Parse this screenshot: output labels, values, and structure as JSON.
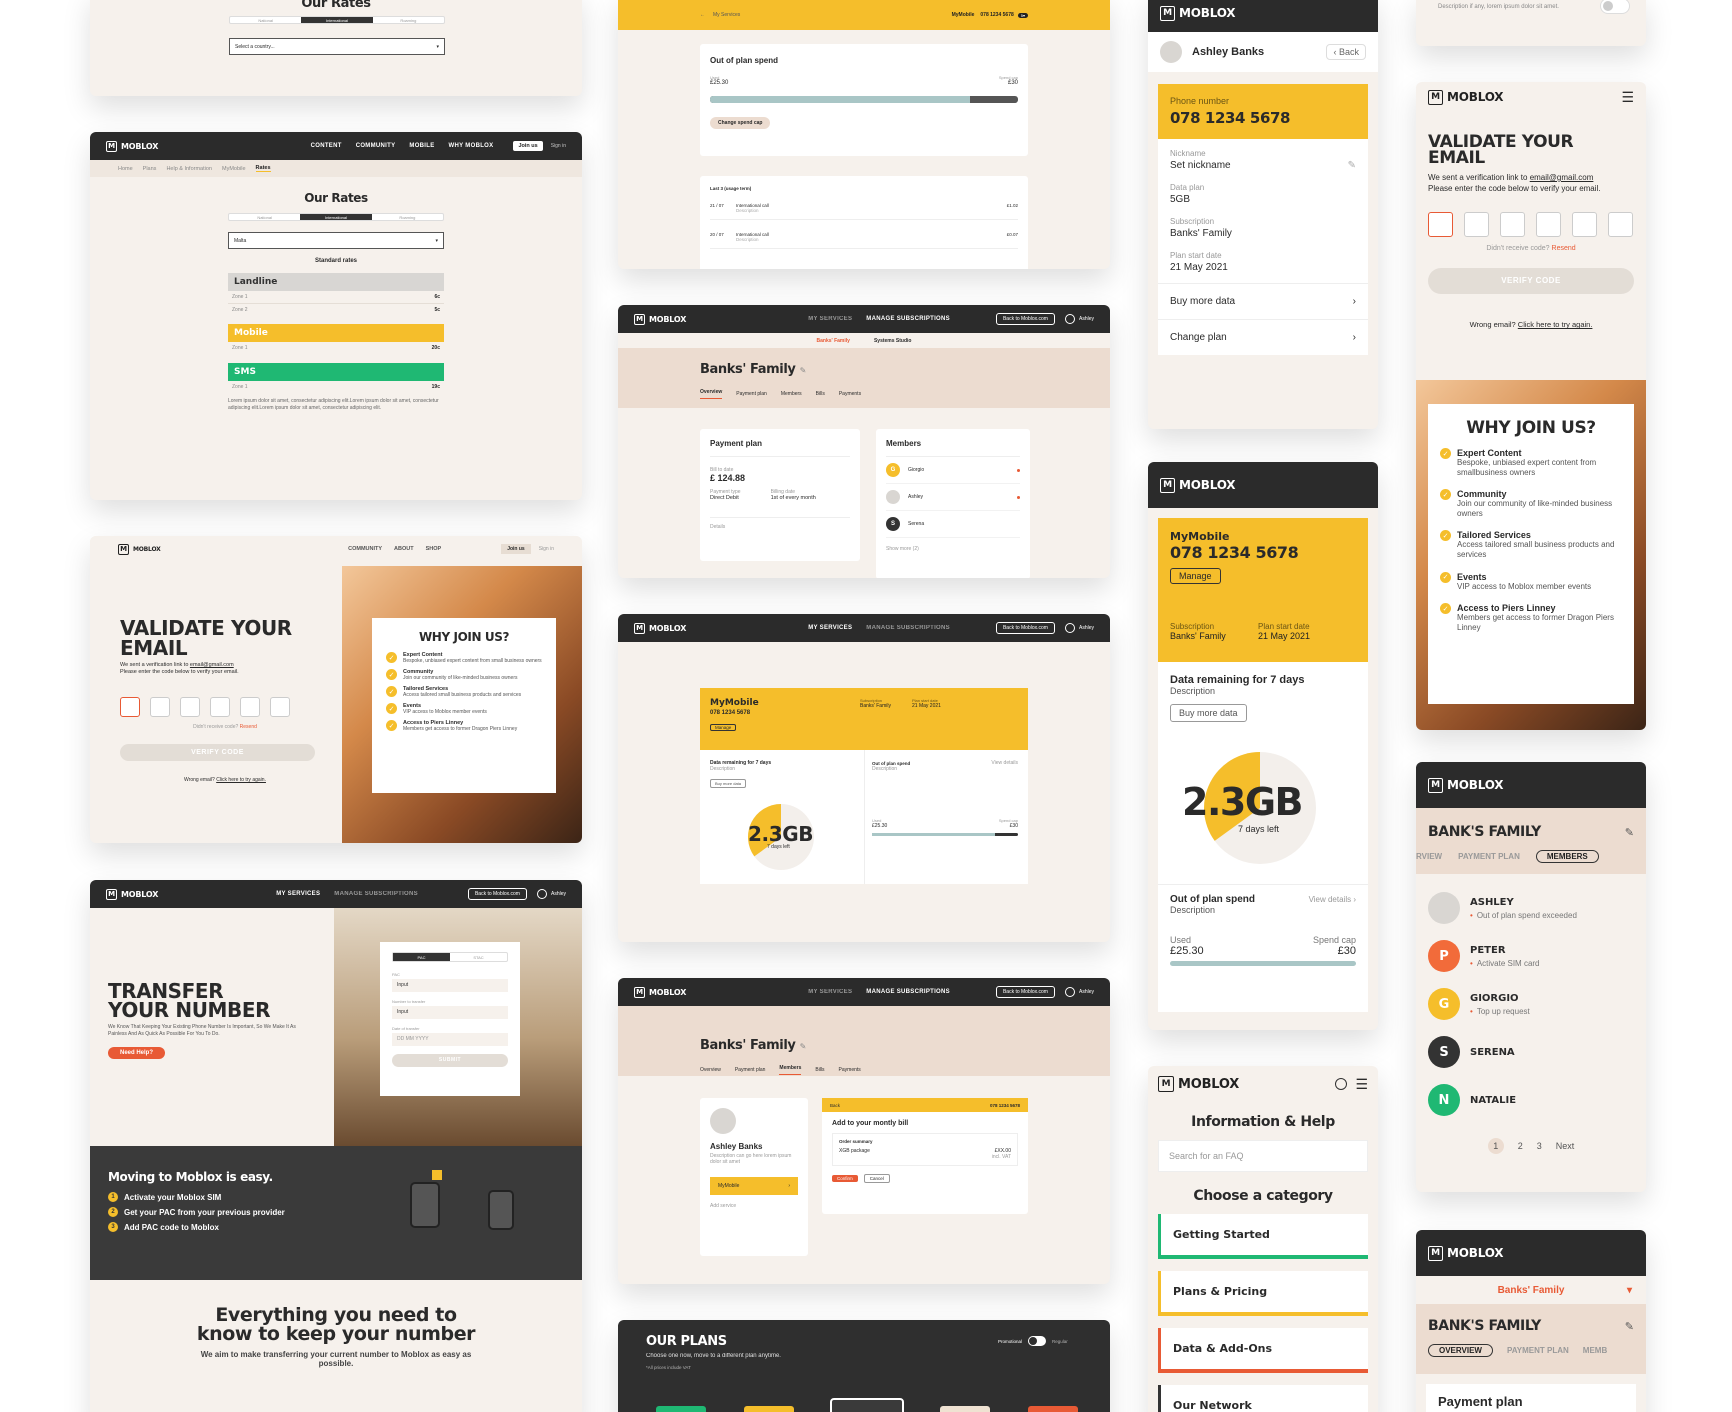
{
  "brand": {
    "name": "MOBLOX",
    "logo_glyph": "M",
    "accent": "#f5be2b",
    "dark": "#2b2b2b",
    "orange": "#e85a35",
    "green": "#1fb873",
    "cream": "#f6f1ec"
  },
  "rates_top": {
    "title": "Our Rates",
    "seg": [
      "National",
      "International",
      "Roaming"
    ],
    "select": "Select a country..."
  },
  "rates": {
    "nav": [
      "CONTENT",
      "COMMUNITY",
      "MOBILE",
      "WHY MOBLOX"
    ],
    "join": "Join us",
    "signin": "Sign in",
    "crumbs": [
      "Home",
      "Plans",
      "Help & Information",
      "MyMobile",
      "Rates"
    ],
    "title": "Our Rates",
    "seg": [
      "National",
      "International",
      "Roaming"
    ],
    "country": "Malta",
    "standard": "Standard rates",
    "landline": {
      "label": "Landline",
      "z1": "Zone 1",
      "v1": "6c",
      "z2": "Zone 2",
      "v2": "5c"
    },
    "mobile": {
      "label": "Mobile",
      "z1": "Zone 1",
      "v1": "20c"
    },
    "sms": {
      "label": "SMS",
      "z1": "Zone 1",
      "v1": "19c"
    },
    "lorem": "Lorem ipsum dolor sit amet, consectetur adipiscing elit.Lorem ipsum dolor sit amet, consectetur adipiscing elit.Lorem ipsum dolor sit amet, consectetur adipiscing elit."
  },
  "validate_desk": {
    "nav": [
      "COMMUNITY",
      "ABOUT",
      "SHOP"
    ],
    "join": "Join us",
    "signin": "Sign in",
    "title1": "VALIDATE YOUR",
    "title2": "EMAIL",
    "sent": "We sent a verification link to",
    "email": "email@gmail.com",
    "enter": "Please enter the code below to verify your email.",
    "didnt": "Didn't receive code?",
    "resend": "Resend",
    "verify": "VERIFY CODE",
    "wrong": "Wrong email?",
    "tryagain": "Click here to try again.",
    "why": "WHY JOIN US?",
    "benefits": [
      {
        "t": "Expert Content",
        "d": "Bespoke, unbiased expert content from small business owners"
      },
      {
        "t": "Community",
        "d": "Join our community of like-minded business owners"
      },
      {
        "t": "Tailored Services",
        "d": "Access tailored small business products and services"
      },
      {
        "t": "Events",
        "d": "VIP access to Moblox member events"
      },
      {
        "t": "Access to Piers Linney",
        "d": "Members get access to former Dragon Piers Linney"
      }
    ]
  },
  "transfer": {
    "nav": [
      "MY SERVICES",
      "MANAGE SUBSCRIPTIONS"
    ],
    "back": "Back to Moblox.com",
    "user": "Ashley",
    "title1": "TRANSFER",
    "title2": "YOUR NUMBER",
    "sub": "We Know That Keeping Your Existing Phone Number Is Important, So We Make It As Painless And As Quick As Possible For You To Do.",
    "help": "Need Help?",
    "tabs": [
      "PAC",
      "STAC"
    ],
    "f1": "PAC",
    "in1": "Input",
    "f2": "Number to transfer",
    "in2": "Input",
    "f3": "Date of transfer",
    "date": "DD  MM  YYYY",
    "submit": "SUBMIT",
    "easy": "Moving to Moblox is easy.",
    "steps": [
      "Activate your Moblox SIM",
      "Get your PAC from your previous provider",
      "Add PAC code to Moblox"
    ],
    "need1": "Everything you need to",
    "need2": "know to keep your number",
    "aim": "We aim to make transferring your current number to Moblox as easy as possible."
  },
  "spend": {
    "back": "My Services",
    "mymobile": "MyMobile",
    "num": "078 1234 5678",
    "title": "Out of plan spend",
    "used": "Used",
    "used_v": "£25.30",
    "cap": "Spend cap",
    "cap_v": "£30",
    "change": "Change spend cap",
    "usage": "Last 3 (usage term)",
    "rows": [
      {
        "d": "21 / 07",
        "t": "International call",
        "s": "Description",
        "v": "£1.02"
      },
      {
        "d": "20 / 07",
        "t": "International call",
        "s": "Description",
        "v": "£0.07"
      }
    ],
    "fill": 0.843
  },
  "family": {
    "nav": [
      "MY SERVICES",
      "MANAGE SUBSCRIPTIONS"
    ],
    "back": "Back to Moblox.com",
    "user": "Ashley",
    "sub": [
      "Banks' Family",
      "Systems Studio"
    ],
    "title": "Banks' Family",
    "tabs": [
      "Overview",
      "Payment plan",
      "Members",
      "Bills",
      "Payments"
    ],
    "pp": "Payment plan",
    "bill": "Bill to date",
    "amt": "£ 124.88",
    "ptype": "Payment type",
    "ptype_v": "Direct Debit",
    "bdate": "Billing date",
    "bdate_v": "1st of every month",
    "details": "Details",
    "members": "Members",
    "m": [
      "Giorgio",
      "Ashley",
      "Serena"
    ],
    "showmore": "Show more (2)"
  },
  "dash": {
    "nav": [
      "MY SERVICES",
      "MANAGE SUBSCRIPTIONS"
    ],
    "back": "Back to Moblox.com",
    "user": "Ashley",
    "mm": "MyMobile",
    "num": "078 1234 5678",
    "manage": "Manage",
    "subl": "Subscription",
    "subv": "Banks' Family",
    "psl": "Plan start date",
    "psv": "21 May 2021",
    "drem": "Data remaining for 7 days",
    "desc": "Description",
    "buy": "Buy more data",
    "gb": "2.3GB",
    "left": "7 days left",
    "oops": "Out of plan spend",
    "view": "View details",
    "used": "Used",
    "used_v": "£25.30",
    "cap": "Spend cap",
    "cap_v": "£30",
    "data_fraction": 0.35
  },
  "members_desk": {
    "nav": [
      "MY SERVICES",
      "MANAGE SUBSCRIPTIONS"
    ],
    "back": "Back to Moblox.com",
    "user": "Ashley",
    "title": "Banks' Family",
    "tabs": [
      "Overview",
      "Payment plan",
      "Members",
      "Bills",
      "Payments"
    ],
    "name": "Ashley Banks",
    "desc": "Description can go here lorem ipsum dolor sit amet",
    "mm": "MyMobile",
    "add": "Add service",
    "backl": "Back",
    "num": "078 1234 5678",
    "addbill": "Add to your montly bill",
    "order": "Order summary",
    "pkg": "XGB package",
    "price": "£XX.00",
    "vat": "incl. VAT",
    "confirm": "Confirm",
    "cancel": "Cancel"
  },
  "plans": {
    "title": "OUR PLANS",
    "sub": "Choose one now, move to a different plan anytime.",
    "note": "*All prices include VAT",
    "promo": "Promotional",
    "reg": "Regular"
  },
  "m_profile": {
    "name": "Ashley Banks",
    "back": "Back",
    "pn": "Phone number",
    "num": "078 1234 5678",
    "nick": "Nickname",
    "nick_v": "Set nickname",
    "dp": "Data plan",
    "dp_v": "5GB",
    "sub": "Subscription",
    "sub_v": "Banks' Family",
    "ps": "Plan start date",
    "ps_v": "21 May 2021",
    "buy": "Buy more data",
    "change": "Change plan"
  },
  "m_dash": {
    "mm": "MyMobile",
    "num": "078 1234 5678",
    "manage": "Manage",
    "subl": "Subscription",
    "subv": "Banks' Family",
    "psl": "Plan start date",
    "psv": "21 May 2021",
    "drem": "Data remaining for 7 days",
    "desc": "Description",
    "buy": "Buy more data",
    "gb": "2.3GB",
    "left": "7 days left",
    "oops": "Out of plan spend",
    "view": "View details",
    "desc2": "Description",
    "used": "Used",
    "used_v": "£25.30",
    "cap": "Spend cap",
    "cap_v": "£30",
    "data_fraction": 0.35
  },
  "m_help": {
    "title": "Information & Help",
    "search": "Search for an FAQ",
    "choose": "Choose a category",
    "cats": [
      "Getting Started",
      "Plans & Pricing",
      "Data & Add-Ons",
      "Our Network"
    ]
  },
  "m_validate": {
    "toggle_desc": "Description if any, lorem ipsum dolor sit amet.",
    "title1": "VALIDATE YOUR",
    "title2": "EMAIL",
    "sent": "We sent a verification link to",
    "email": "email@gmail.com",
    "enter": "Please enter the code below to verify your email.",
    "didnt": "Didn't receive code?",
    "resend": "Resend",
    "verify": "VERIFY CODE",
    "wrong": "Wrong email?",
    "tryagain": "Click here to try again.",
    "why": "WHY JOIN US?",
    "benefits": [
      {
        "t": "Expert Content",
        "d": "Bespoke, unbiased expert content from smallbusiness owners"
      },
      {
        "t": "Community",
        "d": "Join our community of like-minded business owners"
      },
      {
        "t": "Tailored Services",
        "d": "Access tailored small business products and services"
      },
      {
        "t": "Events",
        "d": "VIP access to Moblox member events"
      },
      {
        "t": "Access to Piers Linney",
        "d": "Members get access to former Dragon Piers Linney"
      }
    ]
  },
  "m_members": {
    "title": "BANK'S FAMILY",
    "tabs": [
      "RVIEW",
      "PAYMENT PLAN",
      "MEMBERS"
    ],
    "list": [
      {
        "n": "ASHLEY",
        "tag": "Out of plan spend exceeded",
        "i": "",
        "c": "#d9d6d2"
      },
      {
        "n": "PETER",
        "tag": "Activate SIM card",
        "i": "P",
        "c": "#f26b3a"
      },
      {
        "n": "GIORGIO",
        "tag": "Top up request",
        "i": "G",
        "c": "#f5be2b"
      },
      {
        "n": "SERENA",
        "tag": "",
        "i": "S",
        "c": "#333333"
      },
      {
        "n": "NATALIE",
        "tag": "",
        "i": "N",
        "c": "#1fb873"
      }
    ],
    "pages": [
      "1",
      "2",
      "3"
    ],
    "next": "Next"
  },
  "m_overview": {
    "sel": "Banks' Family",
    "title": "BANK'S FAMILY",
    "tabs": [
      "OVERVIEW",
      "PAYMENT PLAN",
      "MEMB"
    ],
    "pp": "Payment plan"
  }
}
